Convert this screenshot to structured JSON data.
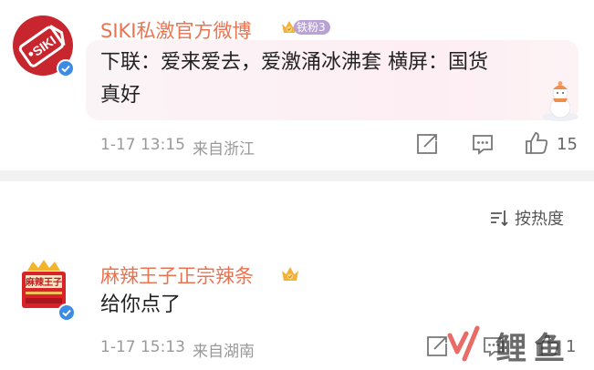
{
  "comments": [
    {
      "username": "SIKI私激官方微博",
      "avatar_logo_text": "SIKI",
      "fan_badge": "铁粉3",
      "text_line1": "下联：爱来爱去，爱激涌冰沸套 横屏：国货",
      "text_line2": "真好",
      "time": "1-17 13:15",
      "location": "来自浙江",
      "like_count": "15",
      "icons": [
        "repost-icon",
        "comment-icon",
        "like-icon"
      ]
    },
    {
      "username": "麻辣王子正宗辣条",
      "avatar_logo_text": "麻辣王子",
      "text": "给你点了",
      "time": "1-17 15:13",
      "location": "来自湖南",
      "like_count": "1",
      "icons": [
        "repost-icon",
        "comment-icon",
        "like-icon"
      ]
    }
  ],
  "sort": {
    "label": "按热度"
  },
  "watermark": {
    "text": "鲤鱼"
  },
  "colors": {
    "username": "#eb7350",
    "verified": "#3c8ce6",
    "meta": "#999999",
    "avatar1": "#c8262e"
  }
}
